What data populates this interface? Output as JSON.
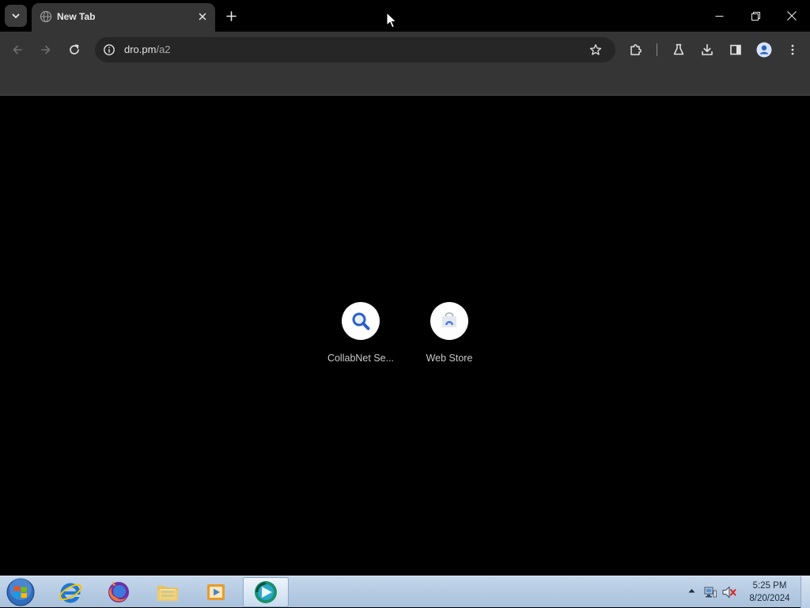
{
  "browser": {
    "tab": {
      "title": "New Tab"
    },
    "omnibox": {
      "host": "dro.pm",
      "path": "/a2"
    }
  },
  "shortcuts": [
    {
      "label": "CollabNet Se...",
      "icon": "magnifier-icon"
    },
    {
      "label": "Web Store",
      "icon": "web-store-icon"
    }
  ],
  "taskbar": {
    "pinned": [
      "internet-explorer-icon",
      "firefox-icon",
      "file-explorer-icon",
      "media-player-icon",
      "active-app-icon"
    ],
    "clock": {
      "time": "5:25 PM",
      "date": "8/20/2024"
    }
  },
  "colors": {
    "page_bg": "#000000",
    "chrome_bg": "#353535",
    "omnibox_bg": "#262626",
    "taskbar_bg": "#b9cde3"
  }
}
